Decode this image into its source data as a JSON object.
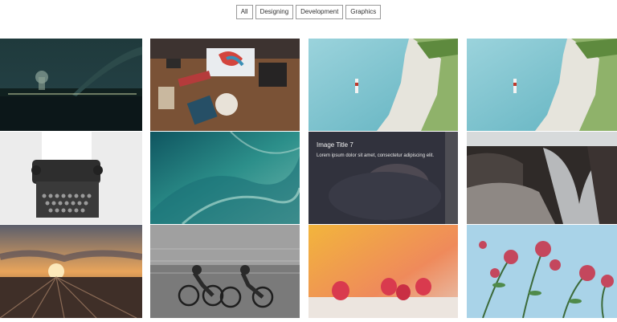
{
  "filters": {
    "all": "All",
    "designing": "Designing",
    "development": "Development",
    "graphics": "Graphics"
  },
  "overlay": {
    "title": "Image Title 7",
    "text": "Lorem ipsum dolor sit amet, consectetur adipiscing elit."
  },
  "colors": {
    "page_background": "#ffffff",
    "button_border": "#9a9a9a",
    "button_text": "#333333",
    "overlay_background": "#1e1e28"
  }
}
